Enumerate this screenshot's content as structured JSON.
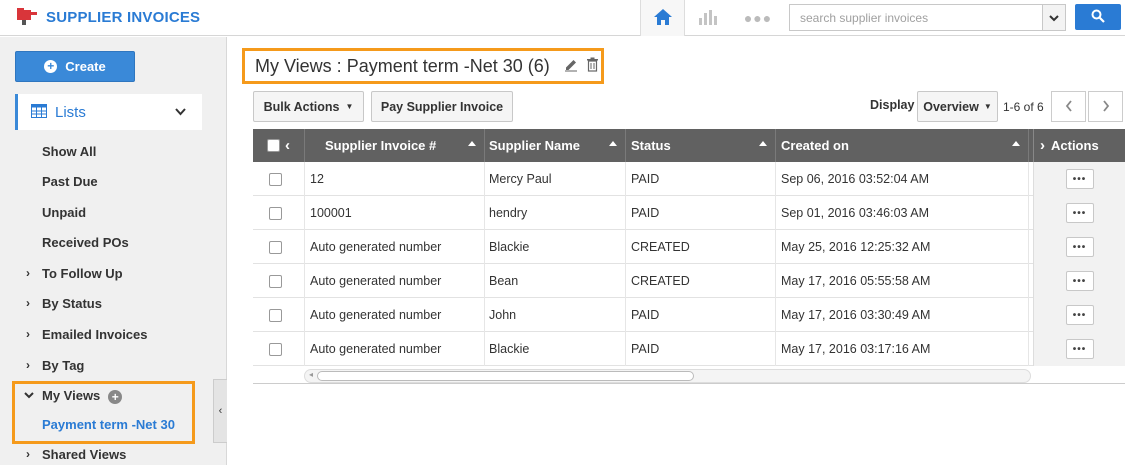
{
  "app": {
    "title": "SUPPLIER INVOICES",
    "search_placeholder": "search supplier invoices"
  },
  "sidebar": {
    "create_label": "Create",
    "lists_label": "Lists",
    "items": [
      {
        "label": "Show All",
        "caret": ""
      },
      {
        "label": "Past Due",
        "caret": ""
      },
      {
        "label": "Unpaid",
        "caret": ""
      },
      {
        "label": "Received POs",
        "caret": ""
      },
      {
        "label": "To Follow Up",
        "caret": "›"
      },
      {
        "label": "By Status",
        "caret": "›"
      },
      {
        "label": "Emailed Invoices",
        "caret": "›"
      },
      {
        "label": "By Tag",
        "caret": "›"
      }
    ],
    "my_views_label": "My Views",
    "my_views_item": "Payment term -Net 30",
    "shared_views_label": "Shared Views"
  },
  "main": {
    "view_title": "My Views : Payment term -Net 30 (6)",
    "bulk_actions_label": "Bulk Actions",
    "pay_label": "Pay Supplier Invoice",
    "display_label": "Display",
    "display_value": "Overview",
    "pager_text": "1-6 of 6"
  },
  "table": {
    "columns": [
      "Supplier Invoice #",
      "Supplier Name",
      "Status",
      "Created on",
      "Actions"
    ],
    "rows": [
      [
        "12",
        "Mercy Paul",
        "PAID",
        "Sep 06, 2016 03:52:04 AM"
      ],
      [
        "100001",
        "hendry",
        "PAID",
        "Sep 01, 2016 03:46:03 AM"
      ],
      [
        "Auto generated number",
        "Blackie",
        "CREATED",
        "May 25, 2016 12:25:32 AM"
      ],
      [
        "Auto generated number",
        "Bean",
        "CREATED",
        "May 17, 2016 05:55:58 AM"
      ],
      [
        "Auto generated number",
        "John",
        "PAID",
        "May 17, 2016 03:30:49 AM"
      ],
      [
        "Auto generated number",
        "Blackie",
        "PAID",
        "May 17, 2016 03:17:16 AM"
      ]
    ]
  },
  "colors": {
    "brand": "#2a7bd4",
    "highlight": "#f59a1b",
    "header_bg": "#616161"
  },
  "icons": {
    "logo": "red-folder-icon",
    "home": "home-icon",
    "chart": "bar-chart-icon",
    "more": "ellipsis-icon",
    "search": "search-icon"
  }
}
